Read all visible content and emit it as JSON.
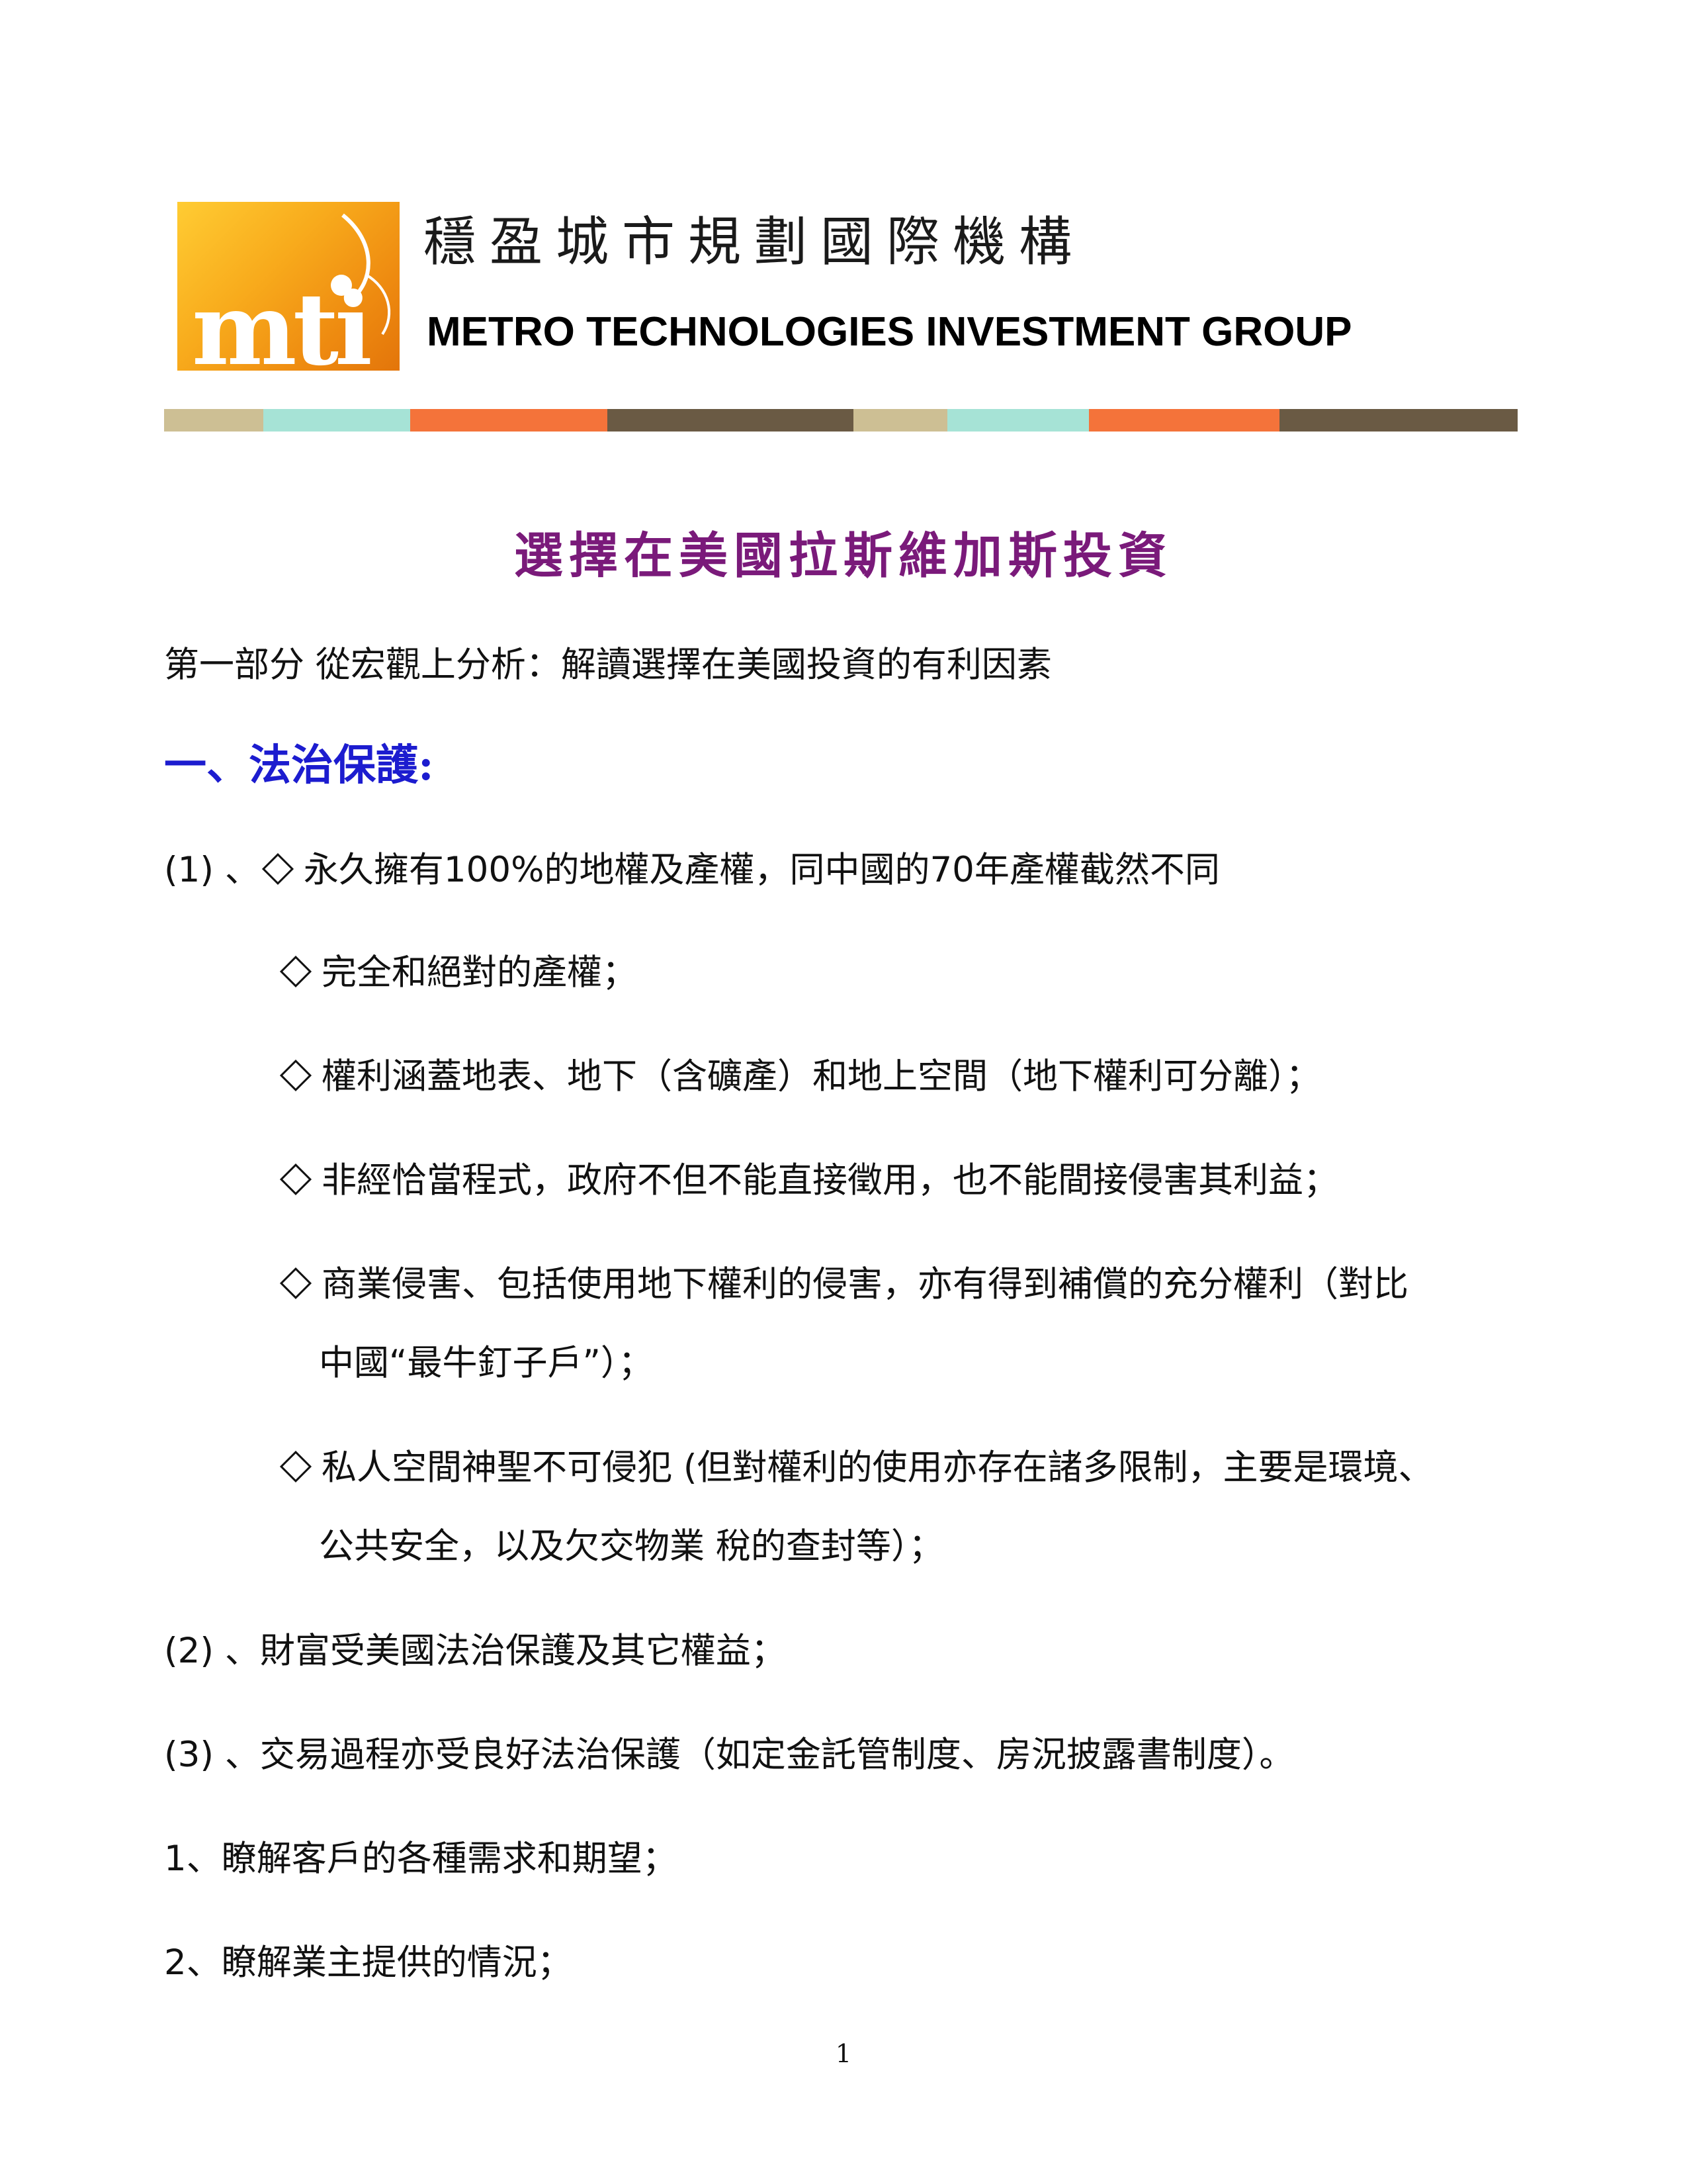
{
  "header": {
    "logo": {
      "text": "mti"
    },
    "org_name_zh": "穩盈城市規劃國際機構",
    "org_name_en": "METRO TECHNOLOGIES INVESTMENT GROUP",
    "stripe_colors": [
      "#cdbf94",
      "#a6e3d6",
      "#f4733a",
      "#6a5a44",
      "#cdbf94",
      "#a6e3d6",
      "#f4733a",
      "#6a5a44"
    ]
  },
  "document": {
    "title": "選擇在美國拉斯維加斯投資",
    "part_heading": "第一部分  從宏觀上分析：解讀選擇在美國投資的有利因素",
    "section_heading": "一、法治保護:",
    "item1": {
      "prefix": "(1) 、",
      "text": "永久擁有100%的地權及產權，同中國的70年產權截然不同"
    },
    "sub_items": [
      {
        "text": "完全和絕對的產權；"
      },
      {
        "text": "權利涵蓋地表、地下（含礦產）和地上空間（地下權利可分離）；"
      },
      {
        "text": "非經恰當程式，政府不但不能直接徵用，也不能間接侵害其利益；"
      },
      {
        "text": "商業侵害、包括使用地下權利的侵害，亦有得到補償的充分權利（對比",
        "continuation": "中國“最牛釘子戶”）；"
      },
      {
        "text": "私人空間神聖不可侵犯  (但對權利的使用亦存在諸多限制，主要是環境、",
        "continuation": "公共安全，以及欠交物業  稅的查封等）；"
      }
    ],
    "item2": "(2) 、財富受美國法治保護及其它權益；",
    "item3": "(3) 、交易過程亦受良好法治保護（如定金託管制度、房況披露書制度）。",
    "numbered": [
      "1、瞭解客戶的各種需求和期望；",
      "2、瞭解業主提供的情況；"
    ]
  },
  "footer": {
    "page_number": "1"
  }
}
